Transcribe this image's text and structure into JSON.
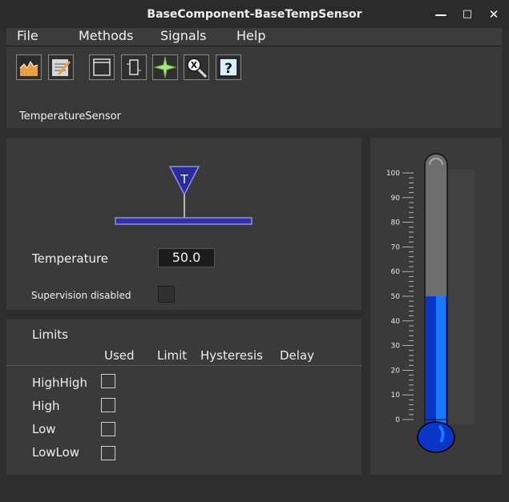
{
  "window": {
    "title": "BaseComponent-BaseTempSensor"
  },
  "menu": [
    "File",
    "Methods",
    "Signals",
    "Help"
  ],
  "toolbar": {
    "buttons": [
      "trend-icon",
      "notes-icon",
      "window-icon",
      "object-icon",
      "crossref-icon",
      "help-icon"
    ],
    "help_glyph": "?",
    "crossref_glyph": "X"
  },
  "object_name": "TemperatureSensor",
  "sensor": {
    "symbol_letter": "T",
    "temperature_label": "Temperature",
    "temperature_value": "50.0",
    "supervision_label": "Supervision disabled",
    "supervision_checked": false
  },
  "limits": {
    "title": "Limits",
    "headers": [
      "Used",
      "Limit",
      "Hysteresis",
      "Delay"
    ],
    "rows": [
      {
        "label": "HighHigh",
        "used": false
      },
      {
        "label": "High",
        "used": false
      },
      {
        "label": "Low",
        "used": false
      },
      {
        "label": "LowLow",
        "used": false
      }
    ]
  },
  "thermometer": {
    "value": 50,
    "min": 0,
    "max": 100,
    "tick_labels": [
      "100",
      "90",
      "80",
      "70",
      "60",
      "50",
      "40",
      "30",
      "20",
      "10",
      "0"
    ],
    "fill_color": "#0a36c8",
    "empty_color": "#6e6e6e"
  }
}
